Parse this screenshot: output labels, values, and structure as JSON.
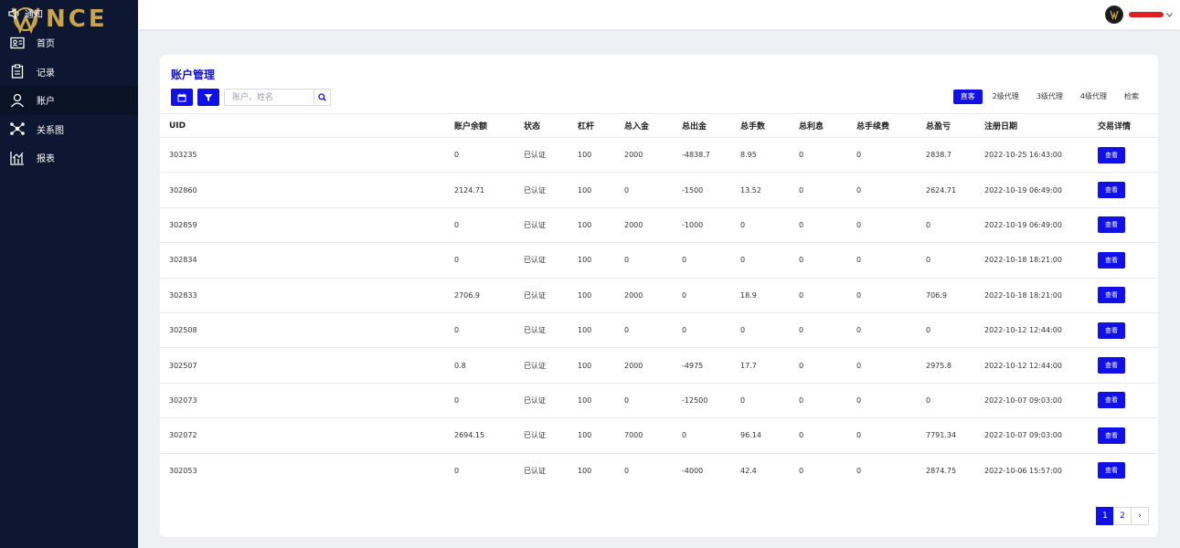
{
  "brand": {
    "logo_text": "NCE",
    "notice_label": "通知"
  },
  "sidebar": {
    "items": [
      {
        "label": "首页",
        "icon": "id-card-icon"
      },
      {
        "label": "记录",
        "icon": "clipboard-icon"
      },
      {
        "label": "账户",
        "icon": "user-icon",
        "active": true
      },
      {
        "label": "关系图",
        "icon": "network-icon"
      },
      {
        "label": "报表",
        "icon": "chart-icon"
      }
    ]
  },
  "page": {
    "title": "账户管理",
    "search_placeholder": "账户、姓名",
    "tabs": [
      "直客",
      "2级代理",
      "3级代理",
      "4级代理",
      "检索"
    ],
    "active_tab": 0
  },
  "table": {
    "columns": [
      "UID",
      "账户余额",
      "状态",
      "杠杆",
      "总入金",
      "总出金",
      "总手数",
      "总利息",
      "总手续费",
      "总盈亏",
      "注册日期",
      "交易详情"
    ],
    "action_label": "查看",
    "rows": [
      [
        "303235",
        "0",
        "已认证",
        "100",
        "2000",
        "-4838.7",
        "8.95",
        "0",
        "0",
        "2838.7",
        "2022-10-25 16:43:00"
      ],
      [
        "302860",
        "2124.71",
        "已认证",
        "100",
        "0",
        "-1500",
        "13.52",
        "0",
        "0",
        "2624.71",
        "2022-10-19 06:49:00"
      ],
      [
        "302859",
        "0",
        "已认证",
        "100",
        "2000",
        "-1000",
        "0",
        "0",
        "0",
        "0",
        "2022-10-19 06:49:00"
      ],
      [
        "302834",
        "0",
        "已认证",
        "100",
        "0",
        "0",
        "0",
        "0",
        "0",
        "0",
        "2022-10-18 18:21:00"
      ],
      [
        "302833",
        "2706.9",
        "已认证",
        "100",
        "2000",
        "0",
        "18.9",
        "0",
        "0",
        "706.9",
        "2022-10-18 18:21:00"
      ],
      [
        "302508",
        "0",
        "已认证",
        "100",
        "0",
        "0",
        "0",
        "0",
        "0",
        "0",
        "2022-10-12 12:44:00"
      ],
      [
        "302507",
        "0.8",
        "已认证",
        "100",
        "2000",
        "-4975",
        "17.7",
        "0",
        "0",
        "2975.8",
        "2022-10-12 12:44:00"
      ],
      [
        "302073",
        "0",
        "已认证",
        "100",
        "0",
        "-12500",
        "0",
        "0",
        "0",
        "0",
        "2022-10-07 09:03:00"
      ],
      [
        "302072",
        "2694.15",
        "已认证",
        "100",
        "7000",
        "0",
        "96.14",
        "0",
        "0",
        "7791.34",
        "2022-10-07 09:03:00"
      ],
      [
        "302053",
        "0",
        "已认证",
        "100",
        "0",
        "-4000",
        "42.4",
        "0",
        "0",
        "2874.75",
        "2022-10-06 15:57:00"
      ]
    ]
  },
  "pagination": {
    "pages": [
      "1",
      "2"
    ],
    "current": "1",
    "next": "›"
  },
  "colors": {
    "accent": "#1010e8",
    "sidebar_bg": "#0d1731",
    "logo_gold": "#c9a44c"
  }
}
